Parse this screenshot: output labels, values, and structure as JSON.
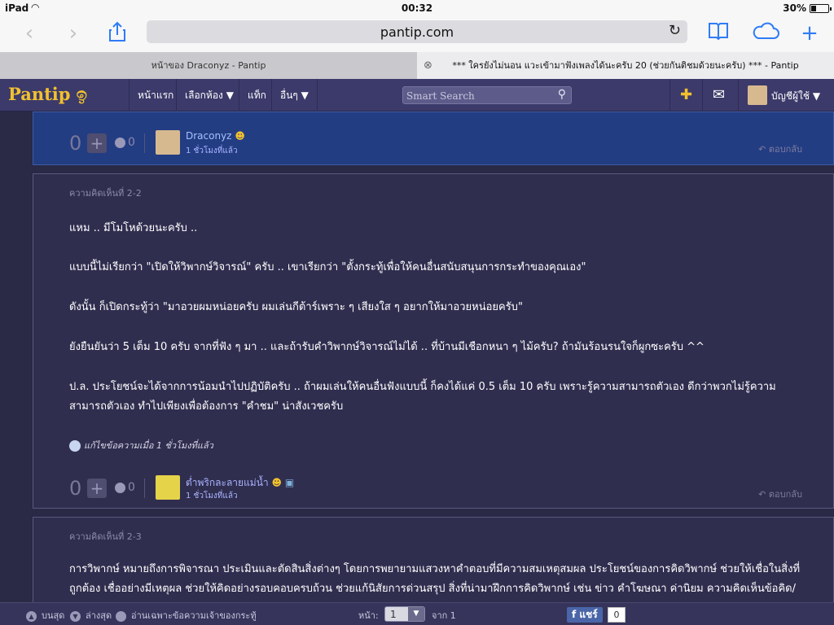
{
  "status_bar": {
    "device": "iPad",
    "time": "00:32",
    "battery_percent": "30%",
    "battery_level": 0.3
  },
  "toolbar": {
    "url": "pantip.com"
  },
  "tabs": [
    {
      "title": "หน้าของ Draconyz - Pantip"
    },
    {
      "title": "*** ใครยังไม่นอน แวะเข้ามาฟังเพลงได้นะครับ 20 (ช่วยกันติชมด้วยนะครับ) *** - Pantip"
    }
  ],
  "nav": {
    "logo": "Pantip",
    "items": [
      "หน้าแรก",
      "เลือกห้อง ▼",
      "แท็ก",
      "อื่นๆ ▼"
    ],
    "search_placeholder": "Smart Search",
    "account_label": "บัญชีผู้ใช้ ▼"
  },
  "top_reply": {
    "votes": "0",
    "emo_count": "0",
    "user": "Draconyz",
    "time": "1 ชั่วโมงที่แล้ว",
    "reply_label": "ตอบกลับ"
  },
  "comment_2_2": {
    "label": "ความคิดเห็นที่ 2-2",
    "paragraphs": [
      "แหม .. มีโมโหด้วยนะครับ ..",
      "แบบนี้ไม่เรียกว่า \"เปิดให้วิพากษ์วิจารณ์\" ครับ .. เขาเรียกว่า \"ตั้งกระทู้เพื่อให้คนอื่นสนับสนุนการกระทำของคุณเอง\"",
      "ดังนั้น ก็เปิดกระทู้ว่า \"มาอวยผมหน่อยครับ ผมเล่นกีต้าร์เพราะ ๆ เสียงใส ๆ อยากให้มาอวยหน่อยครับ\"",
      "ยังยืนยันว่า 5 เต็ม 10 ครับ จากที่ฟัง ๆ มา .. และถ้ารับคำวิพากษ์วิจารณ์ไม่ได้ .. ที่บ้านมีเชือกหนา ๆ ไม้ครับ? ถ้ามันร้อนรนใจก็ผูกซะครับ ^^",
      "ป.ล. ประโยชน์จะได้จากการน้อมนำไปปฏิบัติครับ .. ถ้าผมเล่นให้คนอื่นฟังแบบนี้ ก็คงได้แค่ 0.5 เต็ม 10 ครับ เพราะรู้ความสามารถตัวเอง ดีกว่าพวกไม่รู้ความสามารถตัวเอง ทำไปเพียงเพื่อต้องการ \"คำชม\" น่าสังเวชครับ"
    ],
    "edit_note": "แก้ไขข้อความเมื่อ 1 ชั่วโมงที่แล้ว",
    "votes": "0",
    "emo_count": "0",
    "user": "ต่ำพริกละลายแม่น้ำ",
    "time": "1 ชั่วโมงที่แล้ว",
    "reply_label": "ตอบกลับ"
  },
  "comment_2_3": {
    "label": "ความคิดเห็นที่ 2-3",
    "text": "การวิพากษ์ หมายถึงการพิจารณา ประเมินและตัดสินสิ่งต่างๆ โดยการพยายามแสวงหาคำตอบที่มีความสมเหตุสมผล ประโยชน์ของการคิดวิพากษ์ ช่วยให้เชื่อในสิ่งที่ถูกต้อง เชื่ออย่างมีเหตุผล ช่วยให้คิดอย่างรอบคอบครบถ้วน ช่วยแก้นิสัยการด่วนสรุป สิ่งที่น่ามาฝึกการคิดวิพากษ์ เช่น ข่าว คำโฆษณา ค่านิยม ความคิดเห็นข้อคิด/"
  },
  "bottom_bar": {
    "top_label": "บนสุด",
    "bottom_label": "ล่างสุด",
    "owner_label": "อ่านเฉพาะข้อความเจ้าของกระทู้",
    "page_label": "หน้า:",
    "page_value": "1",
    "of_label": "จาก 1",
    "share_label": "แชร์",
    "share_count": "0"
  }
}
